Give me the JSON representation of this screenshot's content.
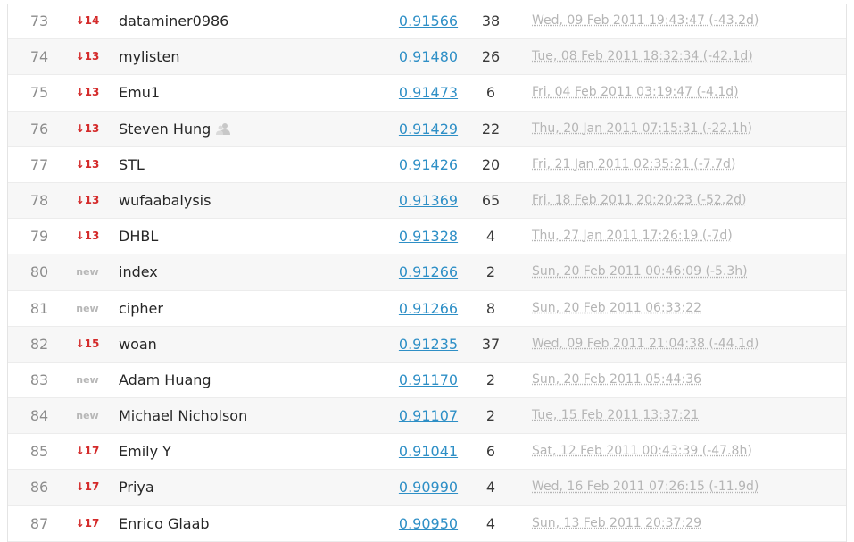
{
  "leaderboard": {
    "rows": [
      {
        "rank": "73",
        "delta": "↓14",
        "delta_type": "down",
        "team": "dataminer0986",
        "score": "0.91566",
        "entries": "38",
        "last": "Wed, 09 Feb 2011 19:43:47 (-43.2d)"
      },
      {
        "rank": "74",
        "delta": "↓13",
        "delta_type": "down",
        "team": "mylisten",
        "score": "0.91480",
        "entries": "26",
        "last": "Tue, 08 Feb 2011 18:32:34 (-42.1d)"
      },
      {
        "rank": "75",
        "delta": "↓13",
        "delta_type": "down",
        "team": "Emu1",
        "score": "0.91473",
        "entries": "6",
        "last": "Fri, 04 Feb 2011 03:19:47 (-4.1d)"
      },
      {
        "rank": "76",
        "delta": "↓13",
        "delta_type": "down",
        "team": "Steven Hung",
        "team_icon": "team-members-icon",
        "score": "0.91429",
        "entries": "22",
        "last": "Thu, 20 Jan 2011 07:15:31 (-22.1h)"
      },
      {
        "rank": "77",
        "delta": "↓13",
        "delta_type": "down",
        "team": "STL",
        "score": "0.91426",
        "entries": "20",
        "last": "Fri, 21 Jan 2011 02:35:21 (-7.7d)"
      },
      {
        "rank": "78",
        "delta": "↓13",
        "delta_type": "down",
        "team": "wufaabalysis",
        "score": "0.91369",
        "entries": "65",
        "last": "Fri, 18 Feb 2011 20:20:23 (-52.2d)"
      },
      {
        "rank": "79",
        "delta": "↓13",
        "delta_type": "down",
        "team": "DHBL",
        "score": "0.91328",
        "entries": "4",
        "last": "Thu, 27 Jan 2011 17:26:19 (-7d)"
      },
      {
        "rank": "80",
        "delta": "new",
        "delta_type": "new",
        "team": "index",
        "score": "0.91266",
        "entries": "2",
        "last": "Sun, 20 Feb 2011 00:46:09 (-5.3h)"
      },
      {
        "rank": "81",
        "delta": "new",
        "delta_type": "new",
        "team": "cipher",
        "score": "0.91266",
        "entries": "8",
        "last": "Sun, 20 Feb 2011 06:33:22"
      },
      {
        "rank": "82",
        "delta": "↓15",
        "delta_type": "down",
        "team": "woan",
        "score": "0.91235",
        "entries": "37",
        "last": "Wed, 09 Feb 2011 21:04:38 (-44.1d)"
      },
      {
        "rank": "83",
        "delta": "new",
        "delta_type": "new",
        "team": "Adam Huang",
        "score": "0.91170",
        "entries": "2",
        "last": "Sun, 20 Feb 2011 05:44:36"
      },
      {
        "rank": "84",
        "delta": "new",
        "delta_type": "new",
        "team": "Michael Nicholson",
        "score": "0.91107",
        "entries": "2",
        "last": "Tue, 15 Feb 2011 13:37:21"
      },
      {
        "rank": "85",
        "delta": "↓17",
        "delta_type": "down",
        "team": "Emily Y",
        "score": "0.91041",
        "entries": "6",
        "last": "Sat, 12 Feb 2011 00:43:39 (-47.8h)"
      },
      {
        "rank": "86",
        "delta": "↓17",
        "delta_type": "down",
        "team": "Priya",
        "score": "0.90990",
        "entries": "4",
        "last": "Wed, 16 Feb 2011 07:26:15 (-11.9d)"
      },
      {
        "rank": "87",
        "delta": "↓17",
        "delta_type": "down",
        "team": "Enrico Glaab",
        "score": "0.90950",
        "entries": "4",
        "last": "Sun, 13 Feb 2011 20:37:29"
      }
    ]
  },
  "colors": {
    "score_link": "#2e8fc6",
    "rank_down": "#d42a2a",
    "rank_new": "#b7b7b7",
    "row_alt": "#f7f7f7"
  }
}
